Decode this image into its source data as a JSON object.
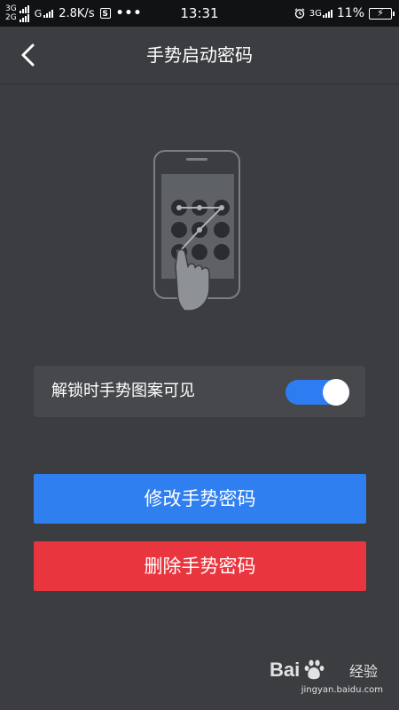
{
  "status_bar": {
    "net_top": "3G",
    "net_bottom": "2G",
    "net_g": "G",
    "speed": "2.8K/s",
    "s_icon": "S",
    "more_dots": "•••",
    "time": "13:31",
    "alarm_icon": "alarm-clock-icon",
    "net_right": "3G",
    "battery_pct": "11%",
    "battery_charging": true
  },
  "header": {
    "title": "手势启动密码",
    "back_icon": "chevron-left-icon"
  },
  "illustration": {
    "icon": "gesture-lock-phone-icon"
  },
  "toggle": {
    "label": "解锁时手势图案可见",
    "checked": true,
    "accent": "#2e7cf2"
  },
  "buttons": {
    "edit_label": "修改手势密码",
    "edit_color": "#2f7ff0",
    "delete_label": "删除手势密码",
    "delete_color": "#e8353e"
  },
  "watermark": {
    "brand": "Bai",
    "brand2": "经验",
    "sub": "jingyan.baidu.com"
  }
}
